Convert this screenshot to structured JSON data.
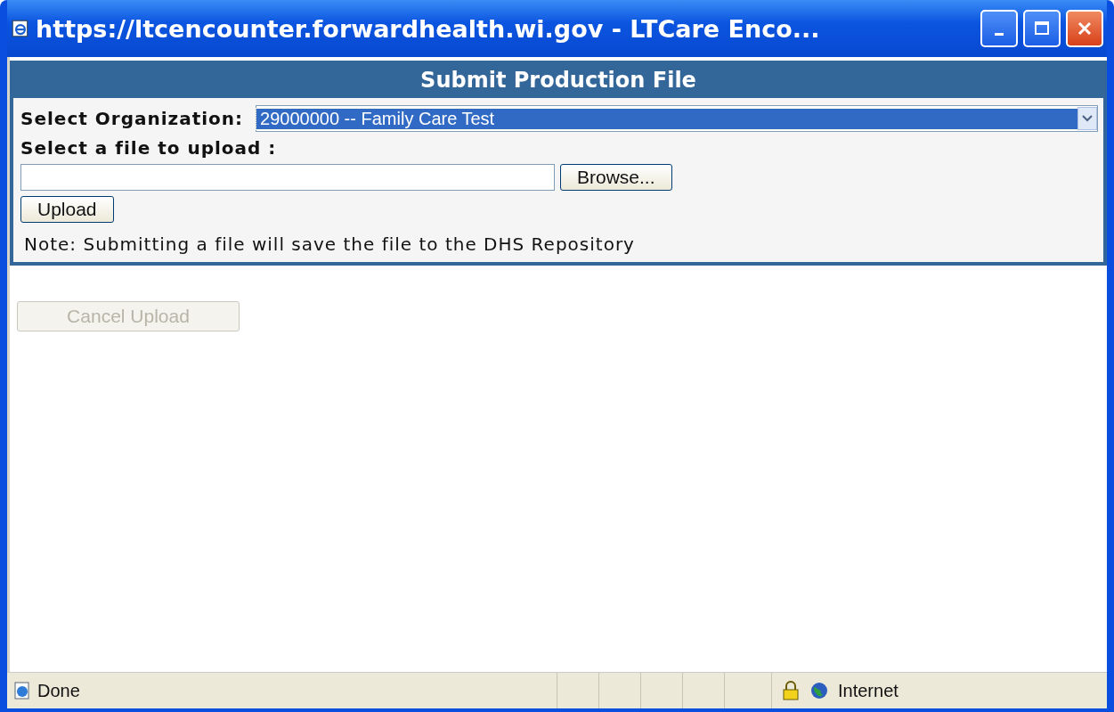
{
  "window": {
    "title": "https://ltcencounter.forwardhealth.wi.gov - LTCare Enco..."
  },
  "panel": {
    "title": "Submit Production File",
    "organization": {
      "label": "Select Organization:",
      "value": "29000000 -- Family Care Test",
      "focused": true
    },
    "file": {
      "label": "Select a file to upload :",
      "browse": "Browse..."
    },
    "upload": {
      "label": "Upload",
      "disabled": false
    },
    "note": "Note: Submitting a file will save the file to the DHS Repository"
  },
  "cancel": {
    "label": "Cancel Upload",
    "disabled": true
  },
  "status_bar": {
    "text": "Done",
    "secure": true,
    "zone": "Internet"
  }
}
